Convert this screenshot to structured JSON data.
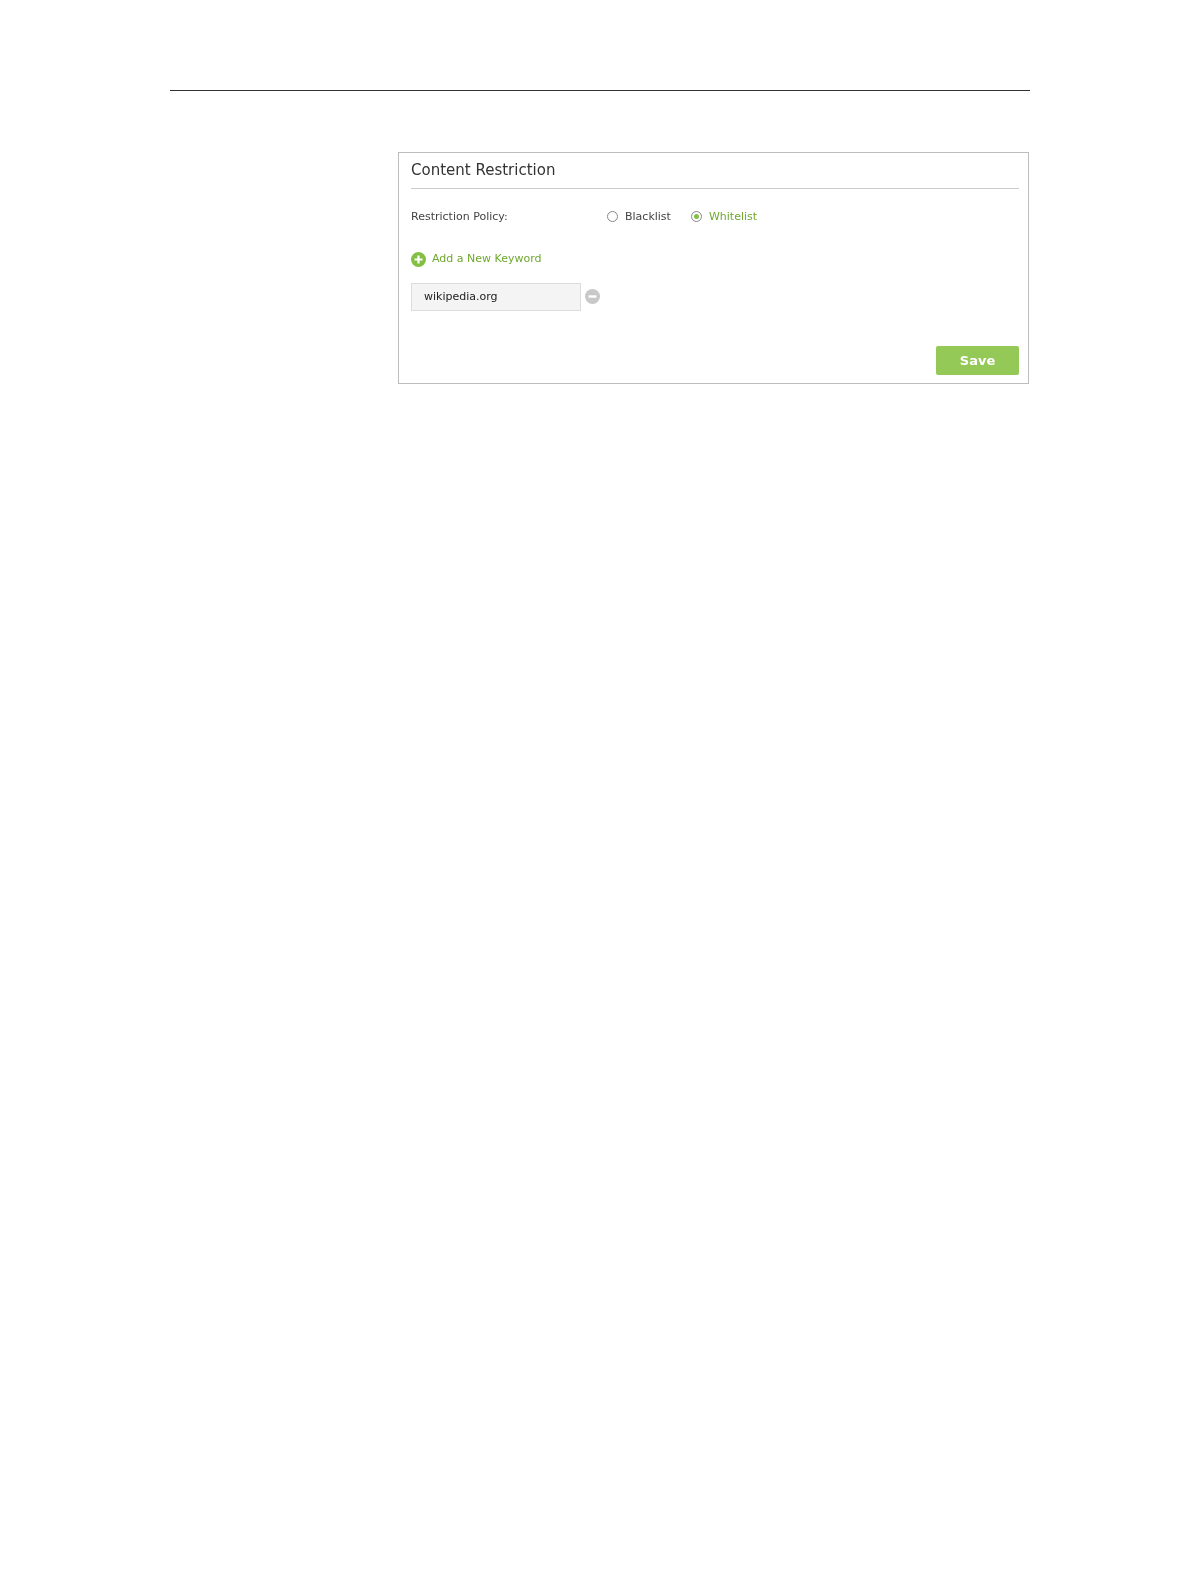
{
  "panel": {
    "title": "Content Restriction",
    "policy": {
      "label": "Restriction Policy:",
      "options": [
        {
          "label": "Blacklist",
          "selected": false
        },
        {
          "label": "Whitelist",
          "selected": true
        }
      ]
    },
    "add_keyword": "Add a New Keyword",
    "keywords": [
      {
        "value": "wikipedia.org"
      }
    ],
    "save": "Save"
  }
}
